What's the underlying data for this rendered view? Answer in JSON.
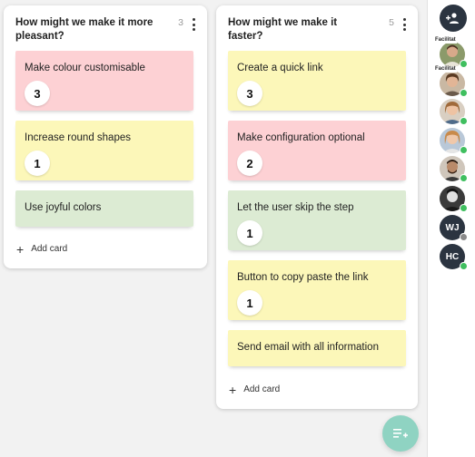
{
  "columns": [
    {
      "title": "How might we make it more pleasant?",
      "count": "3",
      "add_card_label": "Add card",
      "cards": [
        {
          "text": "Make colour customisable",
          "votes": "3",
          "color": "pink"
        },
        {
          "text": "Increase round shapes",
          "votes": "1",
          "color": "yellow"
        },
        {
          "text": "Use joyful colors",
          "votes": "",
          "color": "green"
        }
      ]
    },
    {
      "title": "How might we make it faster?",
      "count": "5",
      "add_card_label": "Add card",
      "cards": [
        {
          "text": "Create a quick link",
          "votes": "3",
          "color": "yellow"
        },
        {
          "text": "Make configuration optional",
          "votes": "2",
          "color": "pink"
        },
        {
          "text": "Let the user skip the step",
          "votes": "1",
          "color": "green"
        },
        {
          "text": "Button to copy paste the link",
          "votes": "1",
          "color": "yellow"
        },
        {
          "text": "Send email with all information",
          "votes": "",
          "color": "yellow"
        }
      ]
    }
  ],
  "sidebar": {
    "participants_icon": "group-add-icon",
    "avatars": [
      {
        "tag": "Facilitat",
        "status": "online"
      },
      {
        "tag": "Facilitat",
        "status": "online"
      },
      {
        "tag": "",
        "status": "online"
      },
      {
        "tag": "",
        "status": "online"
      },
      {
        "tag": "",
        "status": "online"
      },
      {
        "tag": "",
        "status": "online"
      },
      {
        "initials": "WJ",
        "status": "away"
      },
      {
        "initials": "HC",
        "status": "online"
      }
    ]
  },
  "fab": {
    "icon": "add-list-icon"
  },
  "colors": {
    "pink": "#fdd1d4",
    "yellow": "#fcf7b9",
    "green": "#dcebd3",
    "fab": "#8fd3c2",
    "dark": "#2b3440",
    "online": "#3fbf5f"
  }
}
